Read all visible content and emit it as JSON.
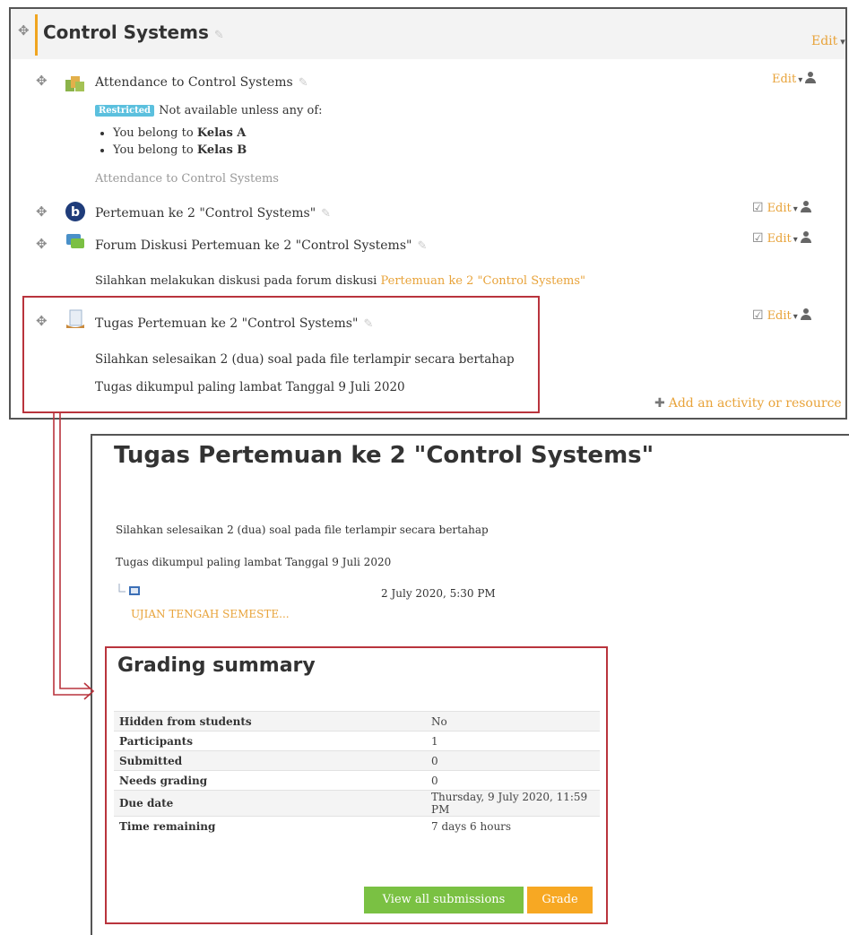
{
  "section": {
    "title": "Control Systems",
    "edit_label": "Edit",
    "add_activity_label": "Add an activity or resource"
  },
  "activities": [
    {
      "name": "Attendance to Control Systems",
      "edit_label": "Edit",
      "restricted_badge": "Restricted",
      "restriction_text": "Not available unless any of:",
      "conditions": [
        {
          "prefix": "You belong to",
          "group": "Kelas A"
        },
        {
          "prefix": "You belong to",
          "group": "Kelas B"
        }
      ],
      "description": "Attendance to Control Systems"
    },
    {
      "name": "Pertemuan ke 2 \"Control Systems\"",
      "edit_label": "Edit"
    },
    {
      "name": "Forum Diskusi Pertemuan ke 2 \"Control Systems\"",
      "edit_label": "Edit",
      "description_prefix": "Silahkan melakukan diskusi pada forum diskusi",
      "description_link": "Pertemuan ke 2 \"Control Systems\""
    },
    {
      "name": "Tugas Pertemuan ke 2 \"Control Systems\"",
      "edit_label": "Edit",
      "description_line1": "Silahkan selesaikan 2 (dua) soal pada file terlampir secara bertahap",
      "description_line2": "Tugas dikumpul paling lambat Tanggal 9 Juli 2020"
    }
  ],
  "assignment": {
    "title": "Tugas Pertemuan ke 2 \"Control Systems\"",
    "intro_line1": "Silahkan selesaikan 2 (dua) soal pada file terlampir secara bertahap",
    "intro_line2": "Tugas dikumpul paling lambat Tanggal 9 Juli 2020",
    "file_date": "2 July 2020, 5:30 PM",
    "file_name": "UJIAN TENGAH SEMESTE..."
  },
  "grading": {
    "title": "Grading summary",
    "rows": [
      {
        "label": "Hidden from students",
        "value": "No"
      },
      {
        "label": "Participants",
        "value": "1"
      },
      {
        "label": "Submitted",
        "value": "0"
      },
      {
        "label": "Needs grading",
        "value": "0"
      },
      {
        "label": "Due date",
        "value": "Thursday, 9 July 2020, 11:59 PM"
      },
      {
        "label": "Time remaining",
        "value": "7 days 6 hours"
      }
    ],
    "view_all_label": "View all submissions",
    "grade_label": "Grade"
  },
  "colors": {
    "accent_orange": "#e8a33a",
    "highlight_red": "#b9343d",
    "button_green": "#7ac143",
    "button_orange": "#f7a823",
    "badge_blue": "#5bc0de"
  }
}
